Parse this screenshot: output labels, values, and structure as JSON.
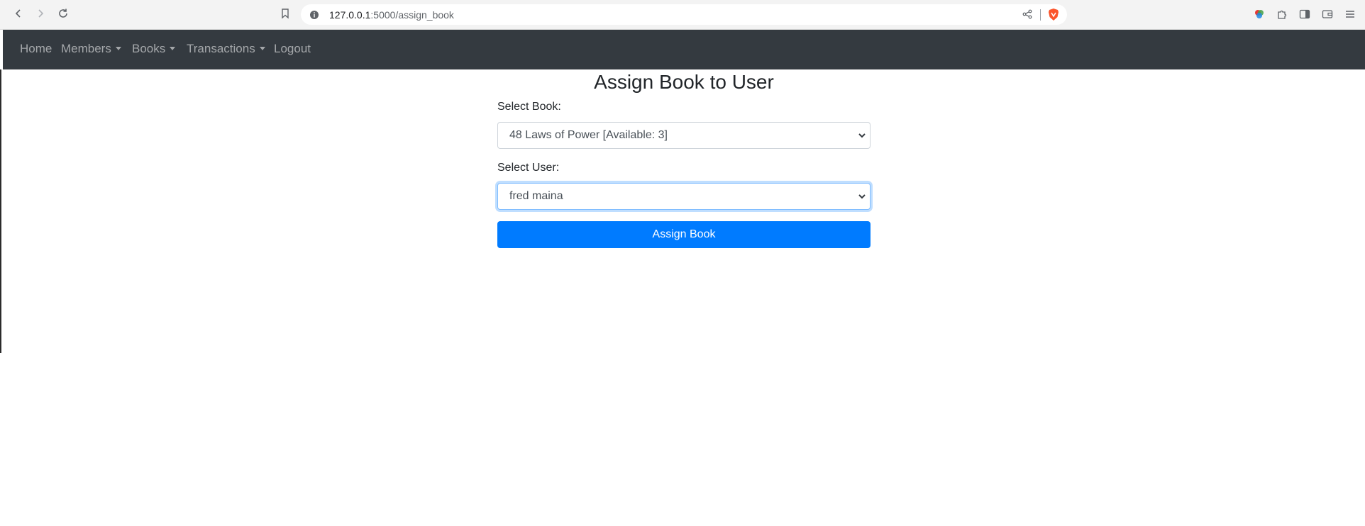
{
  "browser": {
    "url_host": "127.0.0.1",
    "url_path": ":5000/assign_book"
  },
  "navbar": {
    "items": [
      {
        "label": "Home"
      },
      {
        "label": "Members"
      },
      {
        "label": "Books"
      },
      {
        "label": "Transactions"
      },
      {
        "label": "Logout"
      }
    ]
  },
  "form": {
    "title": "Assign Book to User",
    "book_label": "Select Book:",
    "book_selected": "48 Laws of Power [Available: 3]",
    "user_label": "Select User:",
    "user_selected": "fred maina",
    "submit_label": "Assign Book"
  },
  "colors": {
    "navbar_bg": "#343a40",
    "primary": "#007bff"
  }
}
